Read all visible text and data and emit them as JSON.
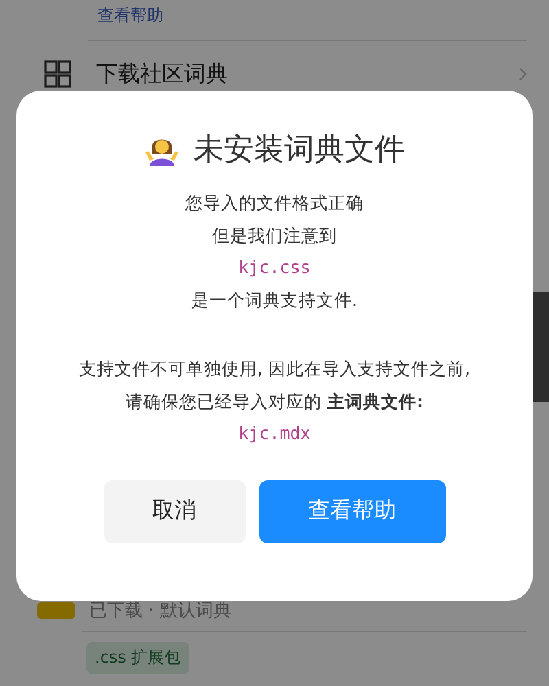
{
  "background": {
    "help_link": "查看帮助",
    "download_row": {
      "label": "下载社区词典"
    },
    "dictionary_status": "已下载 · 默认词典",
    "tag": ".css 扩展包"
  },
  "dialog": {
    "title": "未安装词典文件",
    "lines": [
      {
        "kind": "text",
        "text": "您导入的文件格式正确"
      },
      {
        "kind": "text",
        "text": "但是我们注意到"
      },
      {
        "kind": "file",
        "text": "kjc.css"
      },
      {
        "kind": "text",
        "text": "是一个词典支持文件."
      },
      {
        "kind": "gap"
      },
      {
        "kind": "text",
        "text": "支持文件不可单独使用, 因此在导入支持文件之前,"
      },
      {
        "kind": "text",
        "text": "请确保您已经导入对应的 **主词典文件:**"
      },
      {
        "kind": "file",
        "text": "kjc.mdx"
      }
    ],
    "buttons": [
      {
        "label": "取消",
        "kind": "secondary"
      },
      {
        "label": "查看帮助",
        "kind": "primary"
      }
    ]
  }
}
